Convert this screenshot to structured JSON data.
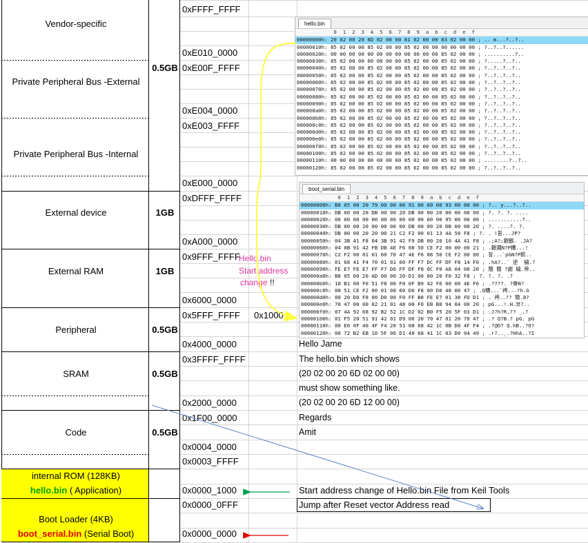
{
  "regions": [
    {
      "label": "Vendor-specific"
    },
    {
      "label": "Private Peripheral Bus -External"
    },
    {
      "label": "Private Peripheral Bus -Internal"
    },
    {
      "label": "External device"
    },
    {
      "label": "External RAM"
    },
    {
      "label": "Peripheral"
    },
    {
      "label": "SRAM"
    },
    {
      "label": "Code"
    },
    {
      "label": "internal ROM   (128KB)",
      "sub_bold": "hello.bin",
      "sub_rest": " ( Application)",
      "sub_color": "#00a000"
    },
    {
      "label": "Boot Loader (4KB)",
      "sub_bold": "boot_serial.bin",
      "sub_rest": " (Serial Boot)",
      "sub_color": "#e00000"
    }
  ],
  "sizes": [
    "0.5GB",
    "1GB",
    "1GB",
    "0.5GB",
    "0.5GB",
    "0.5GB"
  ],
  "addresses": [
    "0xFFFF_FFFF",
    "0xE010_0000",
    "0xE00F_FFFF",
    "0xE004_0000",
    "0xE003_FFFF",
    "0xE000_0000",
    "0xDFFF_FFFF",
    "0xA000_0000",
    "0x9FFF_FFFF",
    "0x6000_0000",
    "0x5FFF_FFFF",
    "0x4000_0000",
    "0x3FFFF_FFFF",
    "0x2000_0000",
    "0x1F00_0000",
    "0x0004_0000",
    "0x0003_FFFF",
    "0x0000_1000",
    "0x0000_0FFF",
    "0x0000_0000"
  ],
  "offset_label": "0x1000",
  "annotation": {
    "line1": "Hello.bin",
    "line2": "Start address",
    "line3": "change",
    "bang": "!!"
  },
  "notes": [
    "Hello Jame",
    "The hello.bin which shows",
    "(20 02 00 20 6D 02 00 00)",
    "must show something like.",
    "(20 02 00 20 6D 12 00 00)",
    "Regards",
    "Amit"
  ],
  "callout_start": "Start address change of  Hello.bin File  from Keil Tools",
  "callout_jump": "Jump after Reset vector Address read",
  "colors": {
    "yellow_fill": "#ffff00",
    "green_arrow": "#00a050",
    "red_arrow": "#e00000",
    "yellow_line": "#ffff40",
    "blue_line": "#5a86c0",
    "selected_row": "#8fd9f8"
  },
  "hex1": {
    "tab": "hello.bin",
    "header": "            0  1  2  3  4  5  6  7  8  9  a  b  c  d  e  f",
    "rows": [
      {
        "off": "00000000h:",
        "hex": "20 02 00 20 6D 02 00 00 81 02 00 00 83 02 00 00",
        "asc": "; .. m...?..?.."
      },
      {
        "off": "00000010h:",
        "hex": "85 02 00 00 85 02 00 00 85 02 00 00 00 00 00 00",
        "asc": "; ?..?..?......"
      },
      {
        "off": "00000020h:",
        "hex": "00 00 00 00 00 00 00 00 00 00 00 00 85 02 00 00",
        "asc": "; ..........?.."
      },
      {
        "off": "00000030h:",
        "hex": "85 02 00 00 00 00 00 00 85 02 00 00 85 02 00 00",
        "asc": "; ?.....?..?.."
      },
      {
        "off": "00000040h:",
        "hex": "85 02 00 00 85 02 00 00 85 02 00 00 85 02 00 00",
        "asc": "; ?..?..?..?.."
      },
      {
        "off": "00000050h:",
        "hex": "85 02 00 00 85 02 00 00 85 02 00 00 85 02 00 00",
        "asc": "; ?..?..?..?.."
      },
      {
        "off": "00000060h:",
        "hex": "85 02 00 00 85 02 00 00 85 02 00 00 85 02 00 00",
        "asc": "; ?..?..?..?.."
      },
      {
        "off": "00000070h:",
        "hex": "85 02 00 00 85 02 00 00 85 02 00 00 85 02 00 00",
        "asc": "; ?..?..?..?.."
      },
      {
        "off": "00000080h:",
        "hex": "85 02 00 00 85 02 00 00 85 02 00 00 85 02 00 00",
        "asc": "; ?..?..?..?.."
      },
      {
        "off": "00000090h:",
        "hex": "85 02 00 00 85 02 00 00 85 02 00 00 85 02 00 00",
        "asc": "; ?..?..?..?.."
      },
      {
        "off": "000000a0h:",
        "hex": "85 02 00 00 85 02 00 00 85 02 00 00 85 02 00 00",
        "asc": "; ?..?..?..?.."
      },
      {
        "off": "000000b0h:",
        "hex": "85 02 00 00 85 02 00 00 85 02 00 00 85 02 00 00",
        "asc": "; ?..?..?..?.."
      },
      {
        "off": "000000c0h:",
        "hex": "85 02 00 00 85 02 00 00 85 02 00 00 85 02 00 00",
        "asc": "; ?..?..?..?.."
      },
      {
        "off": "000000d0h:",
        "hex": "85 02 00 00 85 02 00 00 85 02 00 00 85 02 00 00",
        "asc": "; ?..?..?..?.."
      },
      {
        "off": "000000e0h:",
        "hex": "85 02 00 00 85 02 00 00 85 02 00 00 85 02 00 00",
        "asc": "; ?..?..?..?.."
      },
      {
        "off": "000000f0h:",
        "hex": "85 02 00 00 85 02 00 00 85 02 00 00 85 02 00 00",
        "asc": "; ?..?..?..?.."
      },
      {
        "off": "00000100h:",
        "hex": "85 02 00 00 85 02 00 00 85 02 00 00 85 02 00 00",
        "asc": "; ?..?..?..?.."
      },
      {
        "off": "00000110h:",
        "hex": "00 00 00 00 00 00 00 00 85 02 00 00 85 02 00 00",
        "asc": "; ........?..?.."
      },
      {
        "off": "00000120h:",
        "hex": "85 02 00 00 85 02 00 00 85 02 00 00 85 02 00 00",
        "asc": "; ?..?..?..?.."
      }
    ]
  },
  "hex2": {
    "tab": "boot_serial.bin",
    "header": "            0  1  2  3  4  5  6  7  8  9  a  b  c  d  e  f",
    "rows": [
      {
        "off": "00000000h:",
        "hex": "B8 05 00 20 79 00 00 00 91 00 00 00 93 00 00 00",
        "asc": "; ?.. y...?..?.."
      },
      {
        "off": "00000010h:",
        "hex": "DB 00 00 20 DB 00 00 20 DB 00 00 20 00 00 00 00",
        "asc": "; ?. ?. ?. ...."
      },
      {
        "off": "00000020h:",
        "hex": "00 00 00 00 00 00 00 00 00 00 00 00 95 00 00 00",
        "asc": "; ...........?.."
      },
      {
        "off": "00000030h:",
        "hex": "DB 00 00 20 00 00 00 00 DB 00 00 20 DB 00 00 20",
        "asc": "; ?. ....?. ?."
      },
      {
        "off": "00000040h:",
        "hex": "DB 00 00 20 20 00 21 C2 F2 00 01 13 4A 50 F8",
        "asc": "; ?. . !쥠...JP?"
      },
      {
        "off": "00000050h:",
        "hex": "04 3B 41 F8 04 3B 91 42 F9 DB 00 20 10 4A 41 F8",
        "asc": "; .;A?;觀鶴. .JA?"
      },
      {
        "off": "00000060h:",
        "hex": "04 0B 91 42 FB DB 4E F6 08 50 CE F2 00 00 00 21",
        "asc": "; .觀濺N?P糟...!"
      },
      {
        "off": "00000070h:",
        "hex": "C2 F2 00 01 01 60 70 47 4E F6 88 50 CE F2 00 00",
        "asc": "; 잠...`pGN?P較.."
      },
      {
        "off": "00000080h:",
        "hex": "01 68 41 F4 70 01 01 60 FF F7 DC FF DF F8 14 F0",
        "asc": "; .hA?..` 逆  穢.?"
      },
      {
        "off": "00000090h:",
        "hex": "FE E7 FE E7 FF F7 D6 FF DF F8 0C F0 A8 04 00 20",
        "asc": "; 簡 簡 ?謝 穢.帝.."
      },
      {
        "off": "000000a0h:",
        "hex": "B8 05 00 20 AD 00 00 20 D1 00 00 20 F0 32 F8",
        "asc": "; ?. ?. ?. .?"
      },
      {
        "off": "000000b0h:",
        "hex": "18 B1 00 F0 51 F8 00 F0 0F B9 42 F6 00 00 4E F6",
        "asc": "; .????. ?骨N?"
      },
      {
        "off": "000000c0h:",
        "hex": "08 51 CE F2 00 01 08 60 D0 F8 00 D0 48 00 47",
        "asc": "; .Q糟...`袴...?h.G"
      },
      {
        "off": "000000d0h:",
        "hex": "00 20 D0 F8 00 D0 00 F0 FF B8 FE E7 01 38 FD D1",
        "asc": "; . 袴..?? 簡.8?"
      },
      {
        "off": "000000e0h:",
        "hex": "70 47 00 00 02 21 01 48 00 F0 EB B8 94 04 00 20",
        "asc": "; pG...!.H.뷰?.. "
      },
      {
        "off": "000000f0h:",
        "hex": "07 4A 92 68 92 B2 52 1C D2 02 B0 F5 20 5F 03 D1",
        "asc": "; .J?h?R.?? _.?"
      },
      {
        "off": "00000100h:",
        "hex": "01 F5 20 51 91 42 01 D9 00 20 70 47 01 20 70 47",
        "asc": "; .? Q?B.? pG. pG"
      },
      {
        "off": "00000110h:",
        "hex": "00 E0 0F 40 4F F4 20 51 08 68 42 1C 0B D0 4F F4",
        "asc": "; .?@O? Q.hB..?O?"
      },
      {
        "off": "00000120h:",
        "hex": "00 72 B2 EB 10 5F 06 D1 48 68 41 1C 03 D0 04 49",
        "asc": "; .r?.._.?HhA..?I"
      }
    ]
  }
}
